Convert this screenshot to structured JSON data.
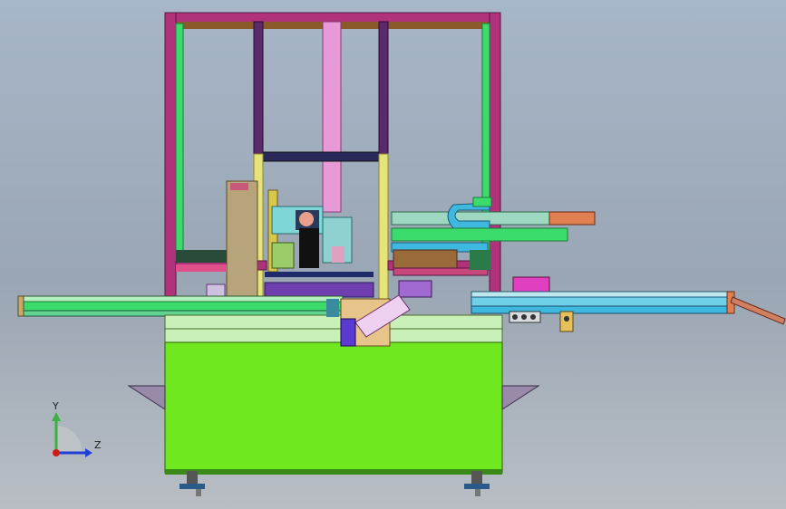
{
  "viewport": {
    "background_top": "#a7b6c8",
    "background_bottom": "#b9bec4"
  },
  "triad": {
    "y_label": "Y",
    "z_label": "Z",
    "y_color": "#3cb043",
    "z_color": "#1f3fd6",
    "x_color": "#d11a1a"
  },
  "colors": {
    "cabinet": "#6fe81f",
    "frame_magenta": "#b0327a",
    "frame_green": "#3bdc6b",
    "pink_column": "#e79ad6",
    "yellow_column": "#e6e37a",
    "conveyor_green": "#5fd38f",
    "conveyor_cyan": "#6fd0e6",
    "navy": "#1f2a6b",
    "tan": "#b7a47a",
    "purple": "#6f3fb0",
    "orange": "#e08050"
  }
}
